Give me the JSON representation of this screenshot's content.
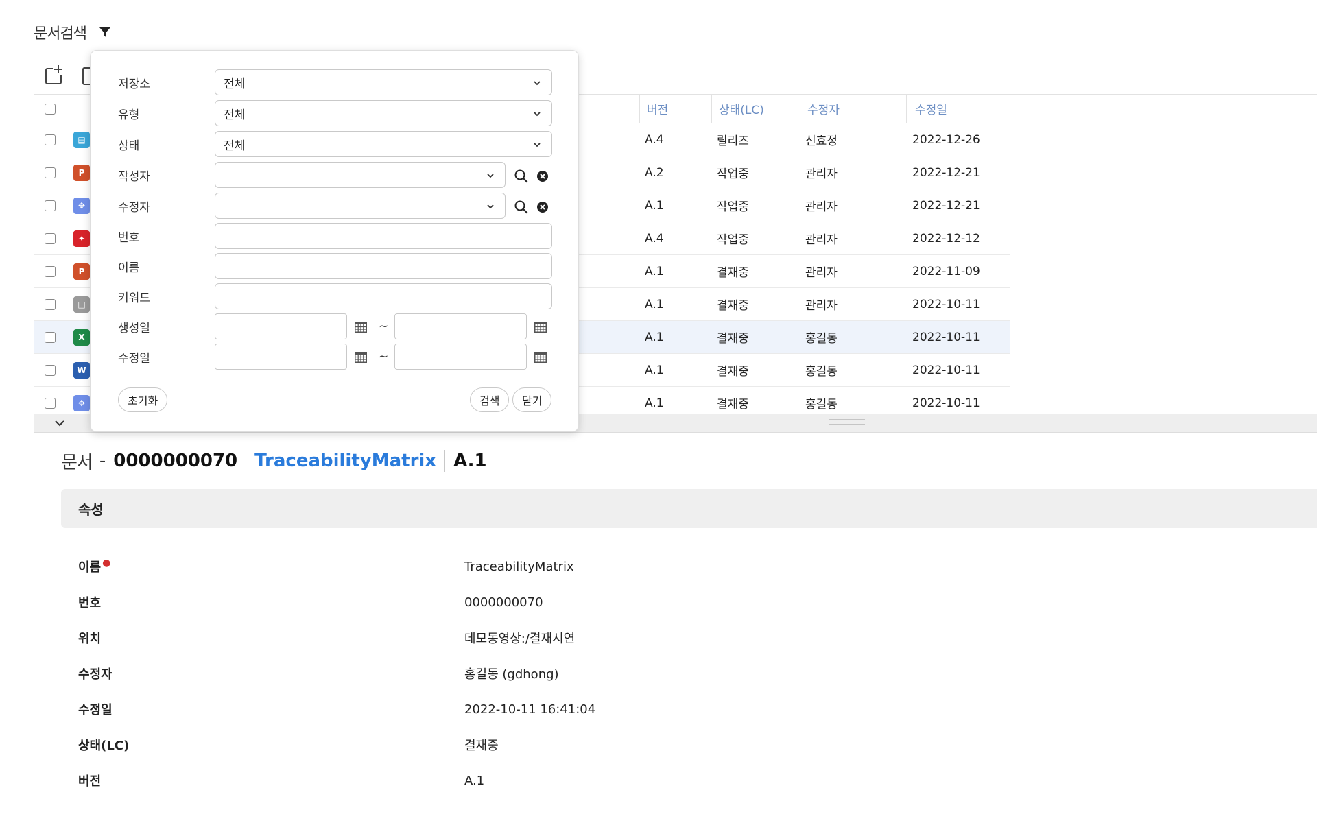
{
  "header": {
    "title": "문서검색"
  },
  "grid": {
    "columns": {
      "version": "버전",
      "state": "상태(LC)",
      "modifier": "수정자",
      "modified": "수정일"
    },
    "rows": [
      {
        "icon": "doc-blue-icon",
        "icon_color": "#3aa6d8",
        "version": "A.4",
        "state": "릴리즈",
        "modifier": "신효정",
        "modified": "2022-12-26"
      },
      {
        "icon": "ppt-icon",
        "icon_color": "#d0502a",
        "version": "A.2",
        "state": "작업중",
        "modifier": "관리자",
        "modified": "2022-12-21"
      },
      {
        "icon": "diagram-icon",
        "icon_color": "#6f8ee8",
        "version": "A.1",
        "state": "작업중",
        "modifier": "관리자",
        "modified": "2022-12-21"
      },
      {
        "icon": "pdf-icon",
        "icon_color": "#d8232a",
        "version": "A.4",
        "state": "작업중",
        "modifier": "관리자",
        "modified": "2022-12-12"
      },
      {
        "icon": "ppt-icon",
        "icon_color": "#d0502a",
        "version": "A.1",
        "state": "결재중",
        "modifier": "관리자",
        "modified": "2022-11-09"
      },
      {
        "icon": "file-generic-icon",
        "icon_color": "#9a9a9a",
        "version": "A.1",
        "state": "결재중",
        "modifier": "관리자",
        "modified": "2022-10-11"
      },
      {
        "icon": "excel-icon",
        "icon_color": "#1f8a48",
        "version": "A.1",
        "state": "결재중",
        "modifier": "홍길동",
        "modified": "2022-10-11"
      },
      {
        "icon": "word-icon",
        "icon_color": "#2b5fb0",
        "version": "A.1",
        "state": "결재중",
        "modifier": "홍길동",
        "modified": "2022-10-11"
      },
      {
        "icon": "diagram-icon",
        "icon_color": "#6f8ee8",
        "version": "A.1",
        "state": "결재중",
        "modifier": "홍길동",
        "modified": "2022-10-11"
      }
    ]
  },
  "filter": {
    "repository": {
      "label": "저장소",
      "value": "전체"
    },
    "type": {
      "label": "유형",
      "value": "전체"
    },
    "state": {
      "label": "상태",
      "value": "전체"
    },
    "author": {
      "label": "작성자",
      "value": ""
    },
    "modifier": {
      "label": "수정자",
      "value": ""
    },
    "number": {
      "label": "번호",
      "value": ""
    },
    "name": {
      "label": "이름",
      "value": ""
    },
    "keyword": {
      "label": "키워드",
      "value": ""
    },
    "created": {
      "label": "생성일",
      "from": "",
      "to": "",
      "sep": "~"
    },
    "modified": {
      "label": "수정일",
      "from": "",
      "to": "",
      "sep": "~"
    },
    "reset_label": "초기화",
    "search_label": "검색",
    "close_label": "닫기"
  },
  "detail": {
    "prefix": "문서",
    "dash": "-",
    "number": "0000000070",
    "name": "TraceabilityMatrix",
    "version": "A.1",
    "section": "속성",
    "properties": [
      {
        "label": "이름",
        "value": "TraceabilityMatrix",
        "required": true
      },
      {
        "label": "번호",
        "value": "0000000070"
      },
      {
        "label": "위치",
        "value": "데모동영상:/결재시연"
      },
      {
        "label": "수정자",
        "value": "홍길동 (gdhong)"
      },
      {
        "label": "수정일",
        "value": "2022-10-11 16:41:04"
      },
      {
        "label": "상태(LC)",
        "value": "결재중"
      },
      {
        "label": "버전",
        "value": "A.1"
      }
    ]
  },
  "colors": {
    "accent": "#2a7bdb",
    "header_text": "#6d8fc4",
    "highlight_row": "#eef3fb"
  }
}
